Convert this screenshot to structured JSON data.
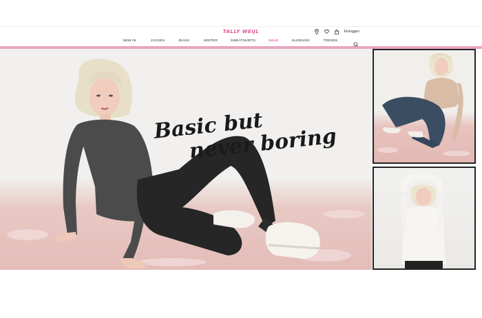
{
  "brand": {
    "logo_text": "TALLY WEiJL",
    "accent": "#e2508f",
    "bar_color": "#e7a6c2"
  },
  "header": {
    "login_label": "Einloggen",
    "icons": [
      "location-icon",
      "heart-icon",
      "bag-icon"
    ]
  },
  "nav": {
    "items": [
      {
        "label": "NEW IN"
      },
      {
        "label": "JACKEN"
      },
      {
        "label": "JEANS"
      },
      {
        "label": "WINTER"
      },
      {
        "label": "SWEATSHIRTS"
      },
      {
        "label": "SALE"
      },
      {
        "label": "KLEIDUNG"
      },
      {
        "label": "TRENDS"
      }
    ],
    "search_icon": "search-icon"
  },
  "hero": {
    "headline_line1": "Basic but",
    "headline_line2": "never boring"
  }
}
